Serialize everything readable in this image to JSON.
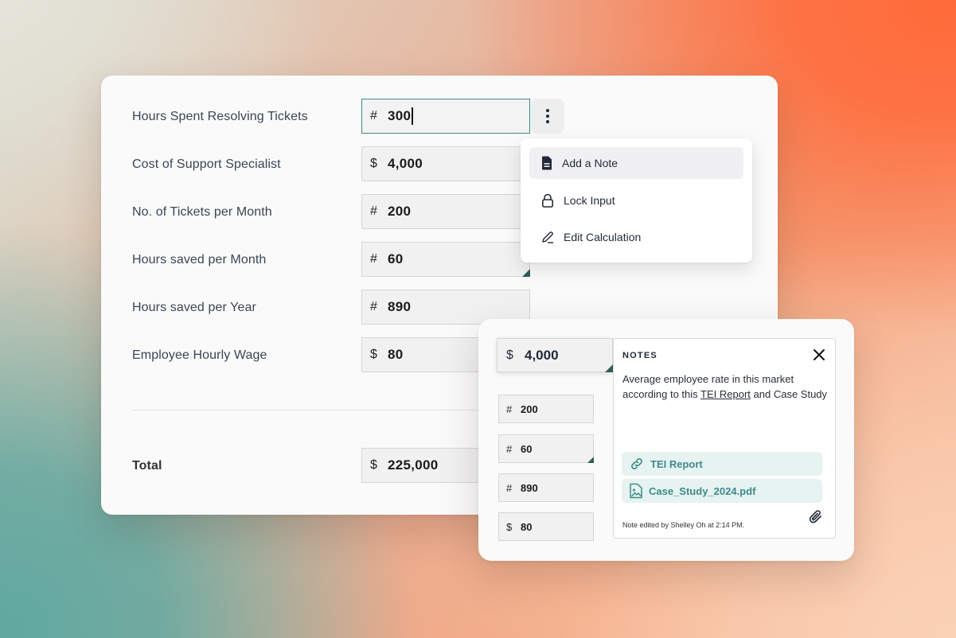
{
  "main": {
    "rows": [
      {
        "label": "Hours Spent Resolving Tickets",
        "symbol": "#",
        "value": "300"
      },
      {
        "label": "Cost of Support Specialist",
        "symbol": "$",
        "value": "4,000"
      },
      {
        "label": "No. of Tickets per Month",
        "symbol": "#",
        "value": "200"
      },
      {
        "label": "Hours saved per Month",
        "symbol": "#",
        "value": "60"
      },
      {
        "label": "Hours saved per Year",
        "symbol": "#",
        "value": "890"
      },
      {
        "label": "Employee Hourly Wage",
        "symbol": "$",
        "value": "80"
      }
    ],
    "total": {
      "label": "Total",
      "symbol": "$",
      "value": "225,000"
    }
  },
  "menu": {
    "items": [
      {
        "label": "Add a Note",
        "icon": "document-icon"
      },
      {
        "label": "Lock Input",
        "icon": "lock-icon"
      },
      {
        "label": "Edit Calculation",
        "icon": "pencil-icon"
      }
    ]
  },
  "notecard": {
    "focused_field": {
      "symbol": "$",
      "value": "4,000"
    },
    "fields": [
      {
        "symbol": "#",
        "value": "200"
      },
      {
        "symbol": "#",
        "value": "60"
      },
      {
        "symbol": "#",
        "value": "890"
      },
      {
        "symbol": "$",
        "value": "80"
      }
    ],
    "notes": {
      "title": "NOTES",
      "body_before": "Average employee rate in this market according to this ",
      "body_link": "TEI Report",
      "body_after": " and Case Study",
      "attachments": [
        {
          "label": "TEI Report",
          "icon": "link-icon"
        },
        {
          "label": "Case_Study_2024.pdf",
          "icon": "image-file-icon"
        }
      ],
      "footer": "Note edited by Shelley Oh at 2:14 PM."
    }
  },
  "colors": {
    "accent": "#3f8a88",
    "corner_marker": "#2e5d5b",
    "chip_bg": "#e6f3f1"
  }
}
